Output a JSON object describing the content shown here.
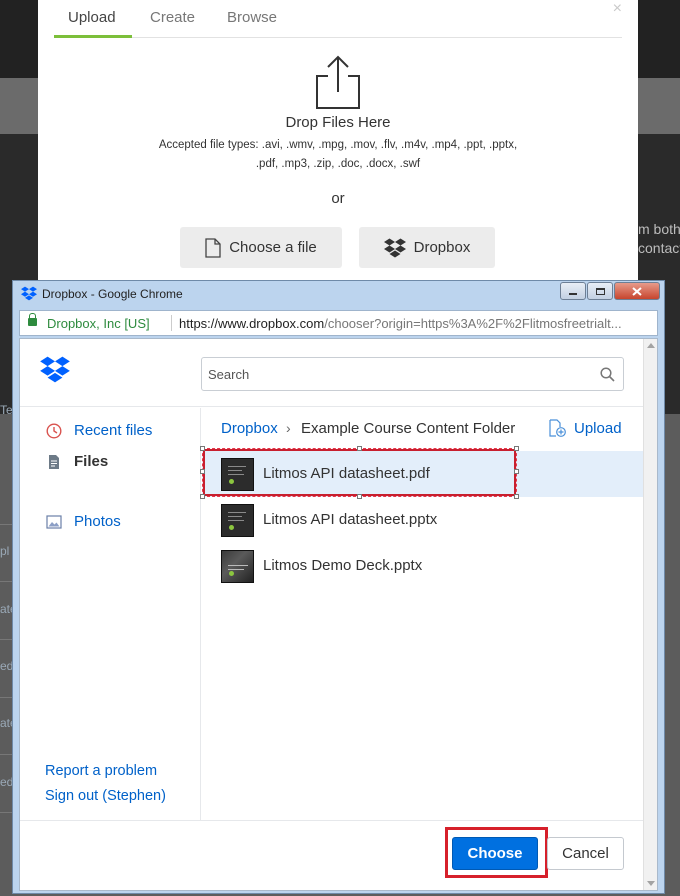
{
  "upload_modal": {
    "tabs": [
      {
        "label": "Upload",
        "active": true
      },
      {
        "label": "Create",
        "active": false
      },
      {
        "label": "Browse",
        "active": false
      }
    ],
    "close_glyph": "×",
    "drop_title": "Drop Files Here",
    "accepted_line1": "Accepted file types: .avi, .wmv, .mpg, .mov, .flv, .m4v, .mp4, .ppt, .pptx,",
    "accepted_line2": ".pdf, .mp3, .zip, .doc, .docx, .swf",
    "or_text": "or",
    "choose_file_label": "Choose a file",
    "dropbox_label": "Dropbox"
  },
  "background": {
    "right_text_1": "m both",
    "right_text_2": "contact",
    "left_fragments": [
      "Te",
      "pl",
      "ate",
      "ed",
      "ate",
      "ed"
    ]
  },
  "window": {
    "title": "Dropbox - Google Chrome",
    "controls": [
      "minimize",
      "maximize",
      "close"
    ],
    "secure_label": "Dropbox, Inc [US]",
    "url_prefix": "https://www.dropbox.com",
    "url_rest": "/chooser?origin=https%3A%2F%2Flitmosfreetrialt..."
  },
  "chooser": {
    "search_placeholder": "Search",
    "sidebar": [
      {
        "label": "Recent files",
        "icon": "clock-icon",
        "active": false
      },
      {
        "label": "Files",
        "icon": "file-icon",
        "active": true
      },
      {
        "label": "Photos",
        "icon": "photo-icon",
        "active": false
      }
    ],
    "report_link": "Report a problem",
    "signout_link": "Sign out (Stephen)",
    "breadcrumb": {
      "root": "Dropbox",
      "separator": "›",
      "folder": "Example Course Content Folder"
    },
    "upload_label": "Upload",
    "files": [
      {
        "name": "Litmos API datasheet.pdf",
        "selected": true,
        "thumb": "dark-doc"
      },
      {
        "name": "Litmos API datasheet.pptx",
        "selected": false,
        "thumb": "dark-doc"
      },
      {
        "name": "Litmos Demo Deck.pptx",
        "selected": false,
        "thumb": "photo"
      }
    ],
    "choose_label": "Choose",
    "cancel_label": "Cancel"
  },
  "colors": {
    "accent_green": "#7cbf3a",
    "dropbox_blue": "#0061c9",
    "choose_button": "#0070e0",
    "highlight_red": "#d6202b",
    "selected_row": "#e3eefa"
  }
}
